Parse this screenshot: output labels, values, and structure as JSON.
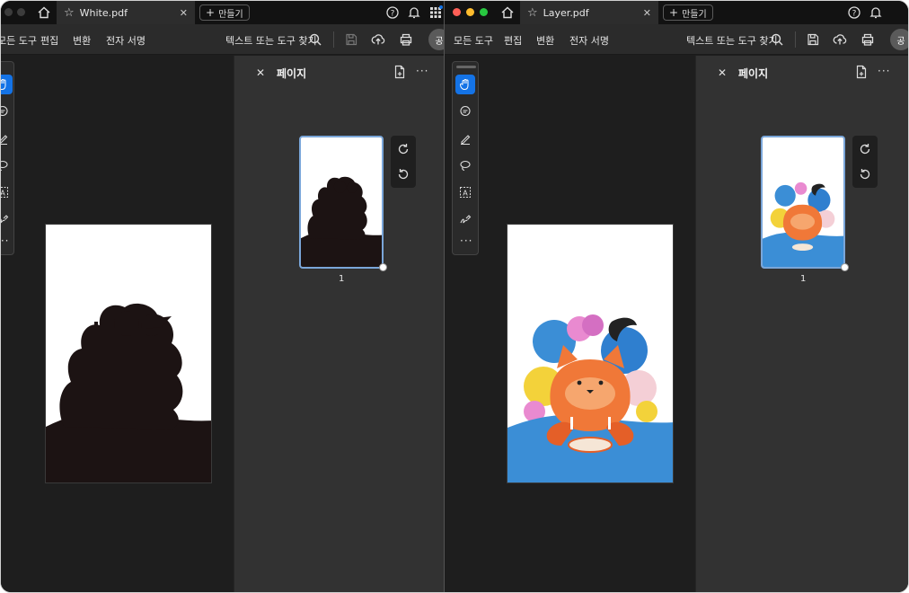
{
  "left_window": {
    "tab_title": "White.pdf",
    "new_tab_label": "만들기",
    "menu": [
      "모든 도구",
      "편집",
      "변환",
      "전자 서명"
    ],
    "search_label": "텍스트 또는 도구 찾기",
    "avatar_initial": "공",
    "panel": {
      "title": "페이지",
      "page_number": "1"
    }
  },
  "right_window": {
    "tab_title": "Layer.pdf",
    "new_tab_label": "만들기",
    "menu": [
      "모든 도구",
      "편집",
      "변환",
      "전자 서명"
    ],
    "search_label": "텍스트 또는 도구 찾기",
    "avatar_initial": "공",
    "panel": {
      "title": "페이지",
      "page_number": "1"
    }
  },
  "colors": {
    "accent": "#1473e6",
    "silhouette": "#1c1313",
    "fox_orange": "#f07838",
    "sky_blue": "#3b8ed6"
  },
  "icons": [
    "home-icon",
    "star-icon",
    "close-icon",
    "help-icon",
    "bell-icon",
    "apps-icon",
    "search-icon",
    "save-icon",
    "upload-icon",
    "print-icon",
    "hand-icon",
    "comment-icon",
    "pen-icon",
    "lasso-icon",
    "text-select-icon",
    "sign-icon",
    "more-icon",
    "add-page-icon",
    "rotate-cw-icon",
    "rotate-ccw-icon"
  ]
}
